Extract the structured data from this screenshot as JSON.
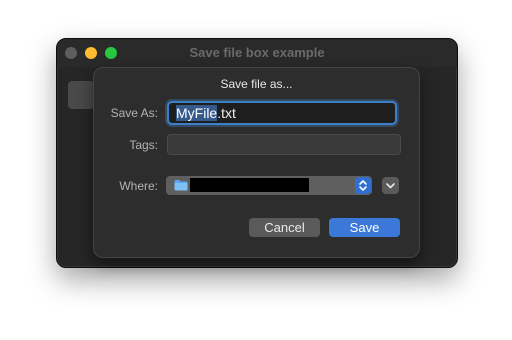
{
  "window": {
    "title": "Save file box example"
  },
  "dialog": {
    "title": "Save file as...",
    "save_as_label": "Save As:",
    "filename_selected": "MyFile",
    "filename_extension": ".txt",
    "tags_label": "Tags:",
    "tags_value": "",
    "where_label": "Where:",
    "where_icon": "folder-icon",
    "cancel_label": "Cancel",
    "save_label": "Save"
  },
  "colors": {
    "accent": "#3b78d8",
    "focus_ring": "#3e7fc7",
    "minimize": "#febc2e",
    "maximize": "#28c840"
  }
}
